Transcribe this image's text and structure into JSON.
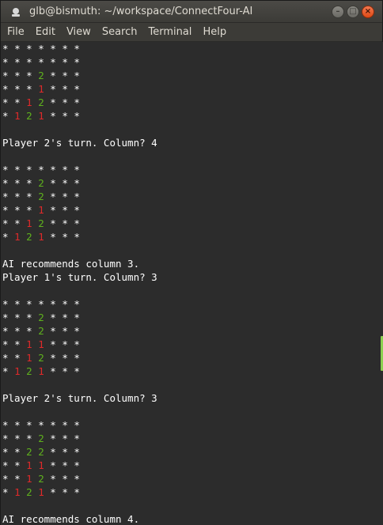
{
  "window": {
    "title": "glb@bismuth: ~/workspace/ConnectFour-AI",
    "buttons": {
      "minimize": "–",
      "maximize": "□",
      "close": "×"
    }
  },
  "menu": [
    "File",
    "Edit",
    "View",
    "Search",
    "Terminal",
    "Help"
  ],
  "colors": {
    "background": "#2c2c2c",
    "text": "#ffffff",
    "player1": "#e02a2a",
    "player2": "#5fb11d"
  },
  "terminal": {
    "lines": [
      "* * * * * * *",
      "* * * * * * *",
      "* * * 2 * * *",
      "* * * 1 * * *",
      "* * 1 2 * * *",
      "* 1 2 1 * * *",
      "",
      "Player 2's turn. Column? 4",
      "",
      "* * * * * * *",
      "* * * 2 * * *",
      "* * * 2 * * *",
      "* * * 1 * * *",
      "* * 1 2 * * *",
      "* 1 2 1 * * *",
      "",
      "AI recommends column 3.",
      "Player 1's turn. Column? 3",
      "",
      "* * * * * * *",
      "* * * 2 * * *",
      "* * * 2 * * *",
      "* * 1 1 * * *",
      "* * 1 2 * * *",
      "* 1 2 1 * * *",
      "",
      "Player 2's turn. Column? 3",
      "",
      "* * * * * * *",
      "* * * 2 * * *",
      "* * 2 2 * * *",
      "* * 1 1 * * *",
      "* * 1 2 * * *",
      "* 1 2 1 * * *",
      "",
      "AI recommends column 4."
    ]
  }
}
